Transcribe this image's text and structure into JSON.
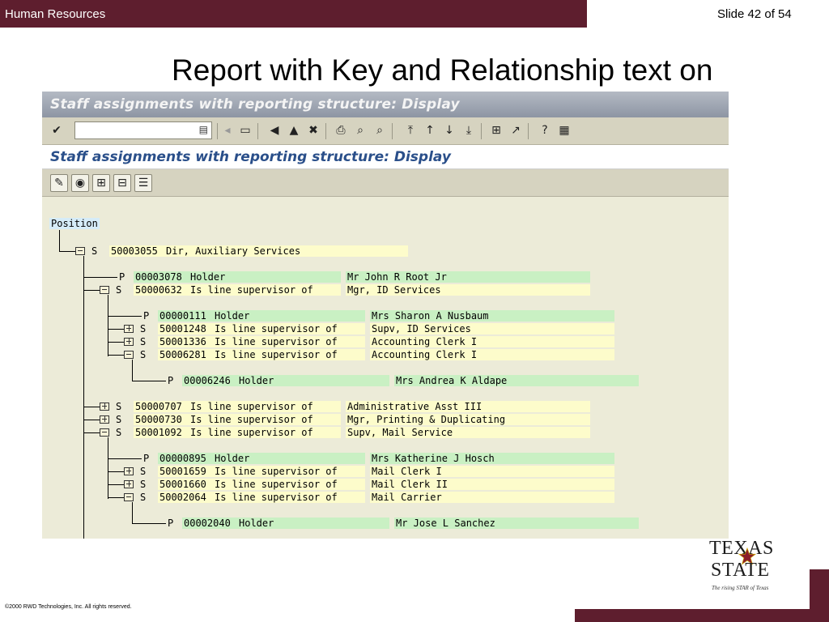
{
  "header": {
    "section": "Human Resources",
    "slide_number": "Slide 42 of 54",
    "title": "Report with Key and Relationship text on"
  },
  "sap": {
    "window_title": "Staff assignments with reporting structure: Display",
    "screen_title": "Staff assignments with reporting structure: Display",
    "root_label": "Position",
    "rows": [
      {
        "type": "S",
        "id": "50003055",
        "relation": "Dir, Auxiliary Services",
        "name": ""
      },
      {
        "type": "P",
        "id": "00003078",
        "relation": "Holder",
        "name": "Mr John R Root Jr"
      },
      {
        "type": "S",
        "id": "50000632",
        "relation": "Is line supervisor of",
        "name": "Mgr, ID Services"
      },
      {
        "type": "P",
        "id": "00000111",
        "relation": "Holder",
        "name": "Mrs Sharon A Nusbaum"
      },
      {
        "type": "S",
        "id": "50001248",
        "relation": "Is line supervisor of",
        "name": "Supv, ID Services"
      },
      {
        "type": "S",
        "id": "50001336",
        "relation": "Is line supervisor of",
        "name": "Accounting Clerk I"
      },
      {
        "type": "S",
        "id": "50006281",
        "relation": "Is line supervisor of",
        "name": "Accounting Clerk I"
      },
      {
        "type": "P",
        "id": "00006246",
        "relation": "Holder",
        "name": "Mrs Andrea K Aldape"
      },
      {
        "type": "S",
        "id": "50000707",
        "relation": "Is line supervisor of",
        "name": "Administrative Asst III"
      },
      {
        "type": "S",
        "id": "50000730",
        "relation": "Is line supervisor of",
        "name": "Mgr, Printing & Duplicating"
      },
      {
        "type": "S",
        "id": "50001092",
        "relation": "Is line supervisor of",
        "name": "Supv, Mail Service"
      },
      {
        "type": "P",
        "id": "00000895",
        "relation": "Holder",
        "name": "Mrs Katherine J Hosch"
      },
      {
        "type": "S",
        "id": "50001659",
        "relation": "Is line supervisor of",
        "name": "Mail Clerk I"
      },
      {
        "type": "S",
        "id": "50001660",
        "relation": "Is line supervisor of",
        "name": "Mail Clerk II"
      },
      {
        "type": "S",
        "id": "50002064",
        "relation": "Is line supervisor of",
        "name": "Mail Carrier"
      },
      {
        "type": "P",
        "id": "00002040",
        "relation": "Holder",
        "name": "Mr Jose L Sanchez"
      }
    ]
  },
  "footer": {
    "copyright": "©2000 RWD Technologies, Inc.  All rights reserved.",
    "logo_top": "TEXAS",
    "logo_bottom": "STATE",
    "logo_tagline": "The rising STAR of Texas"
  },
  "colors": {
    "brand": "#5e1e2e",
    "s_cell": "#fdfccb",
    "p_cell": "#c9f0c3",
    "sap_bg": "#ecebd8"
  }
}
